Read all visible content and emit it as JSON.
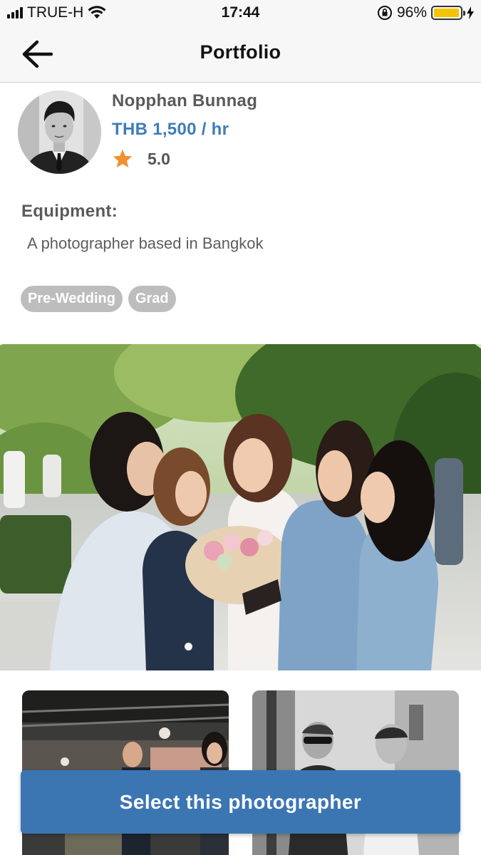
{
  "status_bar": {
    "carrier": "TRUE-H",
    "time": "17:44",
    "battery_percent": "96%",
    "battery_level": 0.96,
    "battery_color": "#f5c400"
  },
  "nav": {
    "back_icon": "arrow-left-icon",
    "title": "Portfolio"
  },
  "profile": {
    "name": "Nopphan Bunnag",
    "price": "THB 1,500 / hr",
    "rating": "5.0",
    "star_color": "#f0902e",
    "price_color": "#3d7db8"
  },
  "details": {
    "equipment_label": "Equipment:",
    "description": "A photographer based in Bangkok"
  },
  "tags": [
    "Pre-Wedding",
    "Grad"
  ],
  "gallery": {
    "hero_icon": "graduation-group-photo",
    "active_slide": 1,
    "slide_count": 1,
    "thumbnails": [
      "event-hall-photo",
      "bw-couple-photo"
    ]
  },
  "cta": {
    "label": "Select this photographer",
    "color": "#3b76b3"
  }
}
